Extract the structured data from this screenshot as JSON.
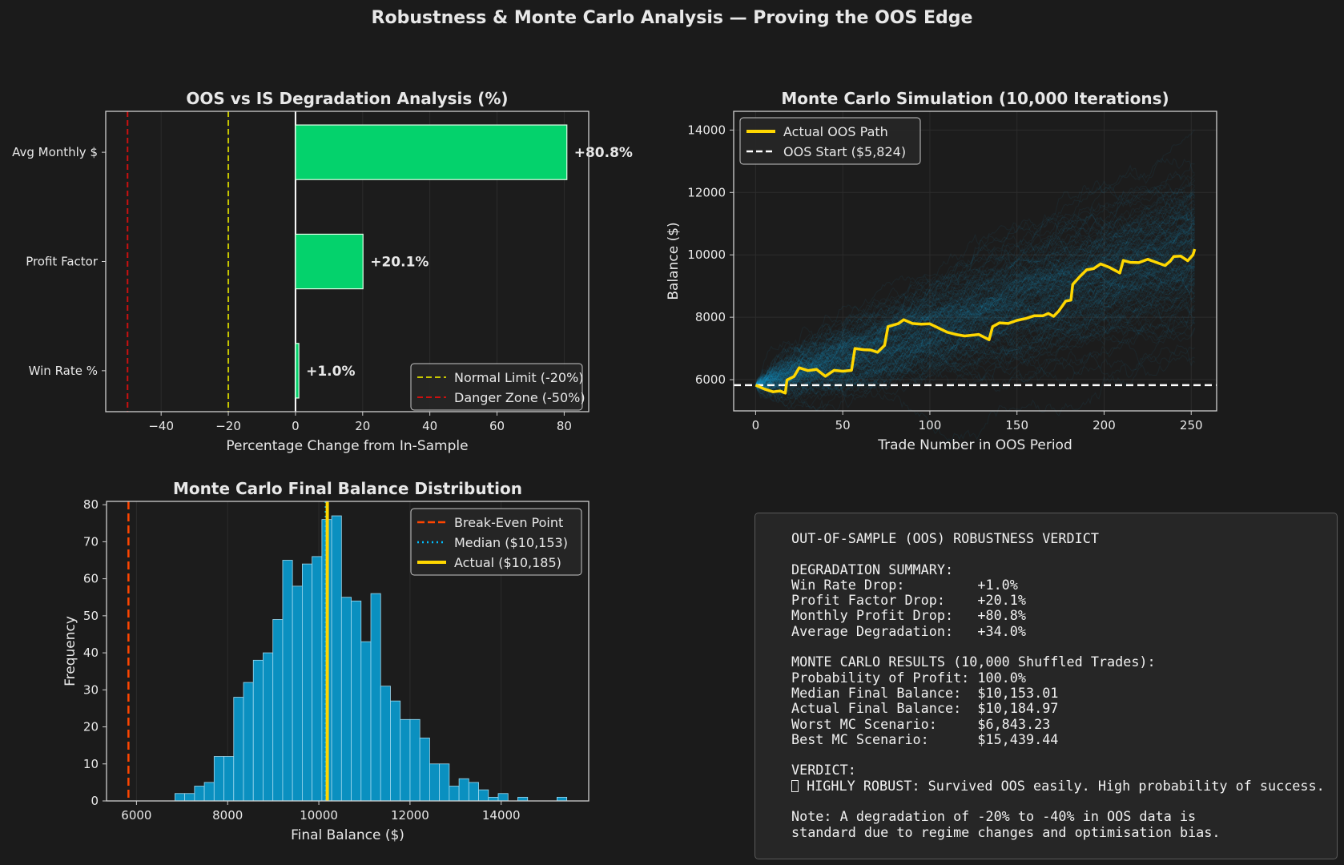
{
  "figure": {
    "title": "Robustness & Monte Carlo Analysis — Proving the OOS Edge",
    "background": "#1b1b1b"
  },
  "chart_data": [
    {
      "type": "bar",
      "orientation": "horizontal",
      "title": "OOS vs IS Degradation Analysis (%)",
      "xlabel": "Percentage Change from In-Sample",
      "ylabel": "",
      "categories": [
        "Win Rate %",
        "Profit Factor",
        "Avg Monthly $"
      ],
      "values": [
        1.0,
        20.1,
        80.8
      ],
      "value_labels": [
        "+1.0%",
        "+20.1%",
        "+80.8%"
      ],
      "xlim": [
        -56.5,
        87.3
      ],
      "xticks": [
        -40,
        -20,
        0,
        20,
        40,
        60,
        80
      ],
      "xtick_labels": [
        "−40",
        "−20",
        "0",
        "20",
        "40",
        "60",
        "80"
      ],
      "bar_color": "#04d26c",
      "reference_lines": [
        {
          "label": "Normal Limit (-20%)",
          "x": -20,
          "color": "#c8c800"
        },
        {
          "label": "Danger Zone (-50%)",
          "x": -50,
          "color": "#cc1010"
        }
      ],
      "legend": "bottom-right",
      "grid": true
    },
    {
      "type": "line",
      "title": "Monte Carlo Simulation (10,000 Iterations)",
      "xlabel": "Trade Number in OOS Period",
      "ylabel": "Balance ($)",
      "xlim": [
        -12.6,
        264.6
      ],
      "ylim": [
        5000,
        14600
      ],
      "xticks": [
        0,
        50,
        100,
        150,
        200,
        250
      ],
      "xtick_labels": [
        "0",
        "50",
        "100",
        "150",
        "200",
        "250"
      ],
      "yticks": [
        6000,
        8000,
        10000,
        12000,
        14000
      ],
      "ytick_labels": [
        "6000",
        "8000",
        "10000",
        "12000",
        "14000"
      ],
      "series": [
        {
          "name": "Actual OOS Path",
          "color": "#ffd700",
          "points": [
            [
              0,
              5824
            ],
            [
              5,
              5700
            ],
            [
              10,
              5610
            ],
            [
              14,
              5640
            ],
            [
              17,
              5570
            ],
            [
              18,
              5990
            ],
            [
              22,
              6100
            ],
            [
              25,
              6380
            ],
            [
              30,
              6290
            ],
            [
              35,
              6330
            ],
            [
              40,
              6110
            ],
            [
              45,
              6300
            ],
            [
              50,
              6270
            ],
            [
              55,
              6300
            ],
            [
              57,
              7000
            ],
            [
              62,
              6960
            ],
            [
              66,
              6950
            ],
            [
              70,
              6880
            ],
            [
              74,
              7100
            ],
            [
              76,
              7700
            ],
            [
              82,
              7800
            ],
            [
              85,
              7920
            ],
            [
              90,
              7800
            ],
            [
              95,
              7780
            ],
            [
              100,
              7790
            ],
            [
              110,
              7520
            ],
            [
              115,
              7450
            ],
            [
              120,
              7400
            ],
            [
              128,
              7450
            ],
            [
              134,
              7280
            ],
            [
              136,
              7700
            ],
            [
              140,
              7820
            ],
            [
              145,
              7800
            ],
            [
              150,
              7900
            ],
            [
              155,
              7960
            ],
            [
              160,
              8050
            ],
            [
              165,
              8050
            ],
            [
              168,
              8120
            ],
            [
              171,
              8030
            ],
            [
              174,
              8200
            ],
            [
              178,
              8520
            ],
            [
              181,
              8550
            ],
            [
              182,
              9050
            ],
            [
              186,
              9300
            ],
            [
              190,
              9520
            ],
            [
              194,
              9560
            ],
            [
              198,
              9710
            ],
            [
              203,
              9600
            ],
            [
              209,
              9420
            ],
            [
              211,
              9820
            ],
            [
              215,
              9760
            ],
            [
              220,
              9750
            ],
            [
              225,
              9860
            ],
            [
              230,
              9760
            ],
            [
              235,
              9660
            ],
            [
              238,
              9800
            ],
            [
              240,
              9950
            ],
            [
              244,
              9960
            ],
            [
              248,
              9810
            ],
            [
              251,
              10000
            ],
            [
              252,
              10185
            ]
          ]
        }
      ],
      "start_line": {
        "label": "OOS Start ($5,824)",
        "y": 5824,
        "color": "#ffffff"
      },
      "simulation_color": "#1ab0e8",
      "legend": "top-left",
      "grid": true
    },
    {
      "type": "bar",
      "subtype": "histogram",
      "title": "Monte Carlo Final Balance Distribution",
      "xlabel": "Final Balance ($)",
      "ylabel": "Frequency",
      "bin_start": 6843.23,
      "bin_end": 15439.44,
      "counts": [
        2,
        2,
        4,
        5,
        12,
        12,
        28,
        32,
        38,
        40,
        49,
        65,
        58,
        64,
        66,
        76,
        77,
        55,
        54,
        43,
        56,
        31,
        27,
        22,
        22,
        17,
        10,
        10,
        4,
        6,
        5,
        3,
        1,
        2,
        0,
        1,
        0,
        0,
        0,
        1
      ],
      "xlim": [
        5343,
        15920
      ],
      "ylim": [
        0,
        80.9
      ],
      "xticks": [
        6000,
        8000,
        10000,
        12000,
        14000
      ],
      "xtick_labels": [
        "6000",
        "8000",
        "10000",
        "12000",
        "14000"
      ],
      "yticks": [
        0,
        10,
        20,
        30,
        40,
        50,
        60,
        70,
        80
      ],
      "ytick_labels": [
        "0",
        "10",
        "20",
        "30",
        "40",
        "50",
        "60",
        "70",
        "80"
      ],
      "bar_color": "#0a90c0",
      "reference_lines": [
        {
          "label": "Break-Even Point",
          "x": 5824,
          "color": "#ff4500",
          "style": "dashed"
        },
        {
          "label": "Median ($10,153)",
          "x": 10153.01,
          "color": "#00bfff",
          "style": "dotted"
        },
        {
          "label": "Actual ($10,185)",
          "x": 10184.97,
          "color": "#ffd700",
          "style": "solid"
        }
      ],
      "legend": "top-right",
      "grid": true
    }
  ],
  "verdict": {
    "heading": "OUT-OF-SAMPLE (OOS) ROBUSTNESS VERDICT",
    "degradation_heading": "DEGRADATION SUMMARY:",
    "degradation": [
      {
        "label": "Win Rate Drop:         ",
        "value": "+1.0%"
      },
      {
        "label": "Profit Factor Drop:    ",
        "value": "+20.1%"
      },
      {
        "label": "Monthly Profit Drop:   ",
        "value": "+80.8%"
      },
      {
        "label": "Average Degradation:   ",
        "value": "+34.0%"
      }
    ],
    "mc_heading": "MONTE CARLO RESULTS (10,000 Shuffled Trades):",
    "mc": [
      {
        "label": "Probability of Profit: ",
        "value": "100.0%"
      },
      {
        "label": "Median Final Balance:  ",
        "value": "$10,153.01"
      },
      {
        "label": "Actual Final Balance:  ",
        "value": "$10,184.97"
      },
      {
        "label": "Worst MC Scenario:     ",
        "value": "$6,843.23"
      },
      {
        "label": "Best MC Scenario:      ",
        "value": "$15,439.44"
      }
    ],
    "verdict_heading": "VERDICT:",
    "verdict_text": " HIGHLY ROBUST: Survived OOS easily. High probability of success.",
    "note_line1": "Note: A degradation of -20% to -40% in OOS data is",
    "note_line2": "standard due to regime changes and optimisation bias."
  }
}
